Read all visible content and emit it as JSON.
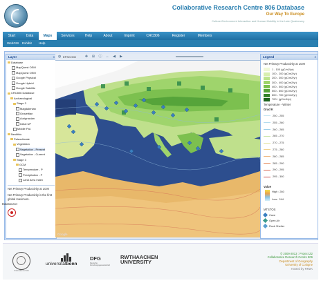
{
  "header": {
    "title": "Collaborative Research Centre 806 Database",
    "subtitle": "Our Way To Europe",
    "description": "Culture-Environment Interaction and Human Mobility in the Late Quaternary"
  },
  "nav": {
    "items": [
      "Start",
      "Data",
      "Maps",
      "Services",
      "Help",
      "About",
      "Imprint",
      "CRC806",
      "Register",
      "Members"
    ],
    "active": "Maps"
  },
  "subnav": {
    "items": [
      "WebGIS",
      "Exhibit",
      "Help"
    ]
  },
  "toolbar": {
    "projection": "EPSG:900"
  },
  "layer_panel": {
    "title": "Layer",
    "tree": [
      "Database",
      "MapQuest OSM",
      "MapQuest OSM",
      "Google Physical",
      "Google Hybrid",
      "Google Satellite",
      "CRC806 Database",
      "Archaeological",
      "Stage 3",
      "Magdalenian",
      "Gravettian",
      "Aurignacian",
      "Initial UP",
      "Middle Pal.",
      "Neolithic",
      "Paleoclimate",
      "Vegetation",
      "Vegetation - Present",
      "Vegetation - Current",
      "Stage 3",
      "GCM",
      "Temperature - P",
      "Precipitation - P",
      "Land Area Index"
    ],
    "description_1": "Net Primary Productivity at LGM",
    "description_2": "Net Primary Productivity is the first global maximum.",
    "datasource_label": "Datasource:"
  },
  "map": {
    "credit": "Google"
  },
  "legend": {
    "title": "Legend",
    "layer_title": "Net Primary Productivity at LGM",
    "npp_classes": [
      {
        "label": "1 - 100 (gC/m2/yr)",
        "color": "#f0f8d8"
      },
      {
        "label": "100 - 200 (gC/m2/yr)",
        "color": "#d8efb0"
      },
      {
        "label": "200 - 300 (gC/m2/yr)",
        "color": "#bde48d"
      },
      {
        "label": "300 - 400 (gC/m2/yr)",
        "color": "#9fd46c"
      },
      {
        "label": "400 - 500 (gC/m2/yr)",
        "color": "#7cc04f"
      },
      {
        "label": "500 - 600 (gC/m2/yr)",
        "color": "#56a43a"
      },
      {
        "label": "600 - 700 (gC/m2/yr)",
        "color": "#34842a"
      },
      {
        "label": "700+ (gC/m2/yr)",
        "color": "#1d631d"
      }
    ],
    "temp_header": "Temperature - Winter",
    "temp_unit": "Grad K",
    "temp_classes": [
      {
        "label": "250 - 255",
        "color": "#c9e6f2"
      },
      {
        "label": "255 - 260",
        "color": "#b4dbee"
      },
      {
        "label": "260 - 265",
        "color": "#9ccfe8"
      },
      {
        "label": "265 - 270",
        "color": "#c8e4a6"
      },
      {
        "label": "270 - 275",
        "color": "#e4e4a0"
      },
      {
        "label": "275 - 280",
        "color": "#f0d28c"
      },
      {
        "label": "280 - 285",
        "color": "#eeb47a"
      },
      {
        "label": "285 - 290",
        "color": "#e69266"
      },
      {
        "label": "290 - 295",
        "color": "#d86a56"
      },
      {
        "label": "295 - 300",
        "color": "#c84848"
      }
    ],
    "value_header": "Value",
    "value_high": "High : 280",
    "value_low": "Low : 244",
    "sites_header": "MTSTOS",
    "sites": [
      {
        "label": "Cave",
        "color": "#3a7fc0"
      },
      {
        "label": "Open Air",
        "color": "#3a9c8c"
      },
      {
        "label": "Rock Shelter",
        "color": "#5aa0d0"
      }
    ]
  },
  "footer": {
    "seal_text": "Universität zu Köln",
    "bonn_text_regular": "universität",
    "bonn_text_bold": "bonn",
    "dfg": "DFG",
    "dfg_sub": "Deutsche Forschungsgemeinschaft",
    "rwth_line1": "RWTHAACHEN",
    "rwth_line2": "UNIVERSITY",
    "right_lines": [
      "© 2009-2013 : Project Z2",
      "Collaborative Research Centre 806",
      "Department of Geography",
      "University of Cologne",
      "",
      "Hosted by RRZK"
    ]
  }
}
